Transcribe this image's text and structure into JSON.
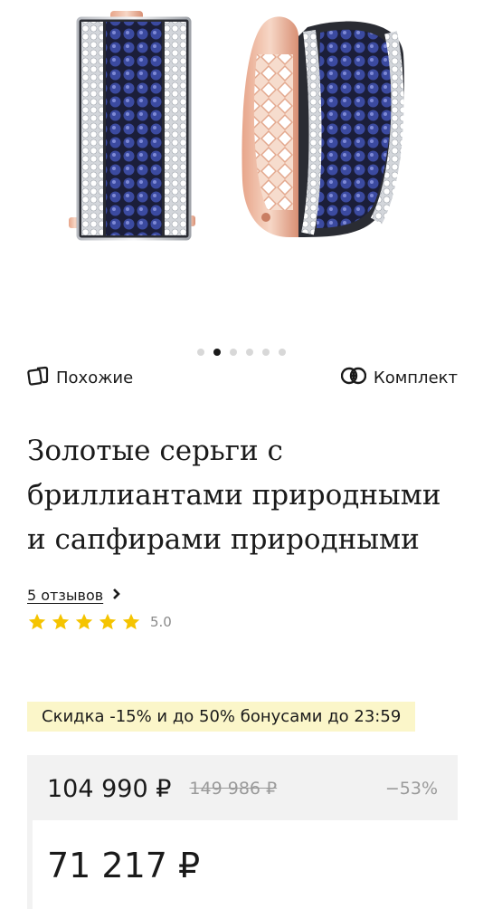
{
  "gallery": {
    "slide_count": 6,
    "active_index": 1
  },
  "actions": {
    "similar_label": "Похожие",
    "set_label": "Комплект"
  },
  "product": {
    "title": "Золотые серьги с бриллиантами природными и сапфирами природными"
  },
  "reviews": {
    "link_text": "5 отзывов",
    "rating": "5.0",
    "stars": 5
  },
  "promo": {
    "text": "Скидка -15% и до 50% бонусами до 23:59"
  },
  "price": {
    "current": "104 990 ₽",
    "original": "149 986 ₽",
    "discount": "−53%",
    "final": "71 217 ₽"
  },
  "colors": {
    "star": "#f5c400",
    "promo_bg": "#fbf6c9",
    "price_box_bg": "#f2f2f2"
  }
}
